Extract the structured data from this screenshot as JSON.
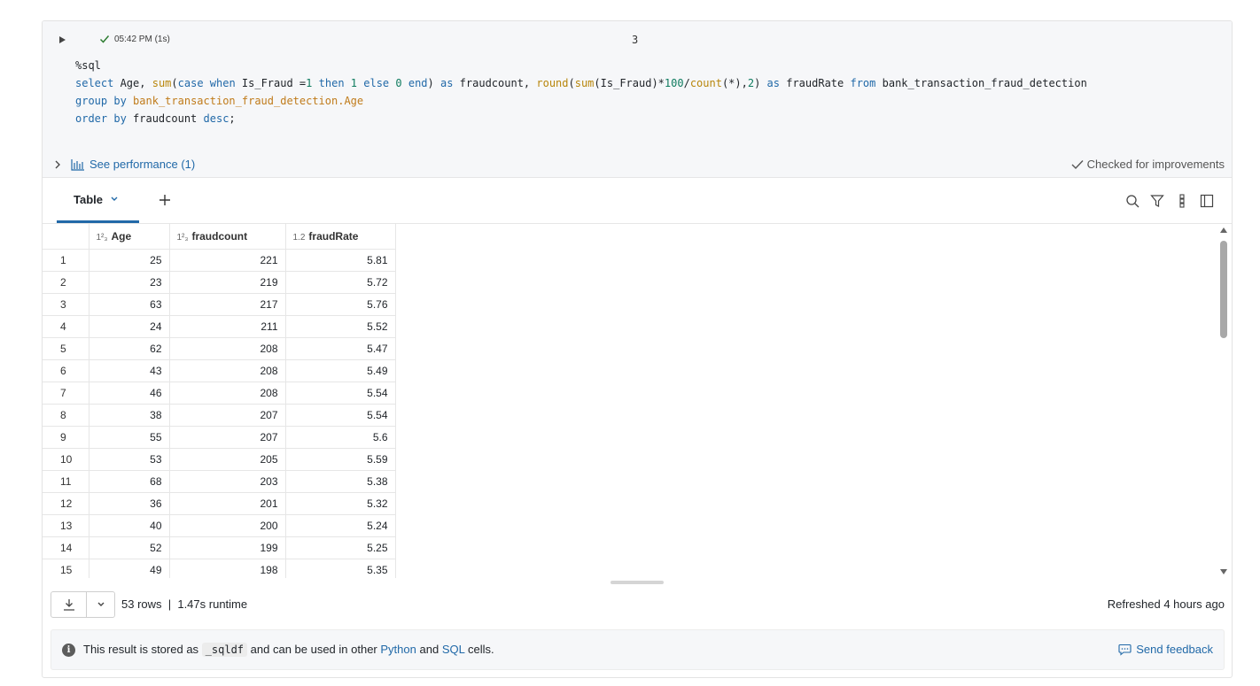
{
  "cell": {
    "status_time": "05:42 PM (1s)",
    "number": "3",
    "code_lines": [
      "%sql",
      "select Age, sum(case when Is_Fraud =1 then 1 else 0 end) as fraudcount, round(sum(Is_Fraud)*100/count(*),2) as fraudRate from bank_transaction_fraud_detection",
      "group by bank_transaction_fraud_detection.Age",
      "order by fraudcount desc;"
    ],
    "perf_link": "See performance (1)",
    "checked": "Checked for improvements"
  },
  "tabs": {
    "table_label": "Table",
    "add_icon": "plus-icon",
    "tools": [
      "search-icon",
      "filter-icon",
      "columns-icon",
      "panel-icon"
    ]
  },
  "table": {
    "type_int": "1²₃",
    "type_dec": "1.2",
    "headers": [
      "Age",
      "fraudcount",
      "fraudRate"
    ],
    "rows": [
      [
        "1",
        "25",
        "221",
        "5.81"
      ],
      [
        "2",
        "23",
        "219",
        "5.72"
      ],
      [
        "3",
        "63",
        "217",
        "5.76"
      ],
      [
        "4",
        "24",
        "211",
        "5.52"
      ],
      [
        "5",
        "62",
        "208",
        "5.47"
      ],
      [
        "6",
        "43",
        "208",
        "5.49"
      ],
      [
        "7",
        "46",
        "208",
        "5.54"
      ],
      [
        "8",
        "38",
        "207",
        "5.54"
      ],
      [
        "9",
        "55",
        "207",
        "5.6"
      ],
      [
        "10",
        "53",
        "205",
        "5.59"
      ],
      [
        "11",
        "68",
        "203",
        "5.38"
      ],
      [
        "12",
        "36",
        "201",
        "5.32"
      ],
      [
        "13",
        "40",
        "200",
        "5.24"
      ],
      [
        "14",
        "52",
        "199",
        "5.25"
      ],
      [
        "15",
        "49",
        "198",
        "5.35"
      ]
    ]
  },
  "footer": {
    "row_info": "53 rows  |  1.47s runtime",
    "refreshed": "Refreshed 4 hours ago"
  },
  "info": {
    "text_pre": "This result is stored as",
    "var_name": "_sqldf",
    "text_mid": "and can be used in other",
    "python": "Python",
    "and": "and",
    "sql": "SQL",
    "cells": "cells.",
    "feedback": "Send feedback"
  },
  "colors": {
    "accent": "#2169a8",
    "code_bg": "#f6f7f9",
    "success": "#2e7d32"
  }
}
